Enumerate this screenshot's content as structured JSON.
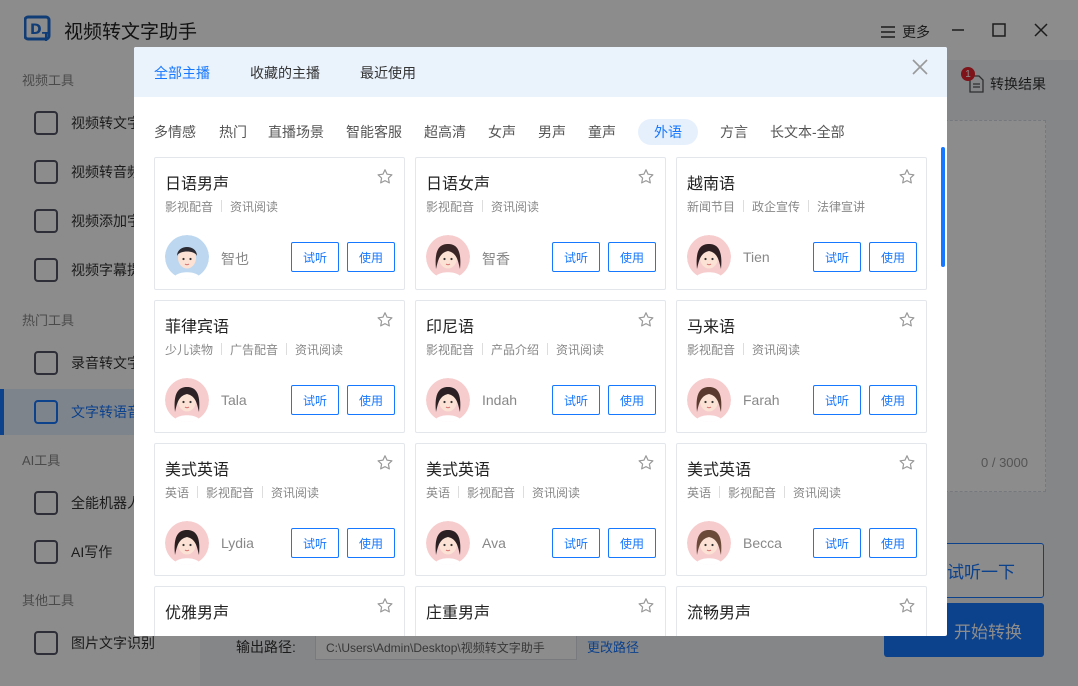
{
  "app": {
    "title": "视频转文字助手",
    "more_label": "更多",
    "result_label": "转换结果",
    "result_badge": "1"
  },
  "sidebar": {
    "sections": [
      "视频工具",
      "热门工具",
      "AI工具",
      "其他工具"
    ],
    "items": [
      {
        "label": "视频转文字",
        "icon": "video-text-icon"
      },
      {
        "label": "视频转音频",
        "icon": "video-audio-icon"
      },
      {
        "label": "视频添加字幕",
        "icon": "video-subtitle-icon"
      },
      {
        "label": "视频字幕提取",
        "icon": "subtitle-extract-icon"
      },
      {
        "label": "录音转文字",
        "icon": "microphone-icon"
      },
      {
        "label": "文字转语音",
        "icon": "text-to-speech-icon"
      },
      {
        "label": "全能机器人",
        "icon": "robot-icon"
      },
      {
        "label": "AI写作",
        "icon": "ai-write-icon"
      },
      {
        "label": "图片文字识别",
        "icon": "image-ocr-icon"
      }
    ]
  },
  "main": {
    "counter": "0 / 3000",
    "listen_button": "试听一下",
    "start_button": "开始转换",
    "output_label": "输出路径:",
    "output_path": "C:\\Users\\Admin\\Desktop\\视频转文字助手",
    "change_path": "更改路径"
  },
  "modal": {
    "tabs": [
      "全部主播",
      "收藏的主播",
      "最近使用"
    ],
    "active_tab": 0,
    "filters": [
      "多情感",
      "热门",
      "直播场景",
      "智能客服",
      "超高清",
      "女声",
      "男声",
      "童声",
      "外语",
      "方言",
      "长文本-全部"
    ],
    "active_filter": 8,
    "try_label": "试听",
    "use_label": "使用",
    "cards": [
      {
        "title": "日语男声",
        "tags": [
          "影视配音",
          "资讯阅读"
        ],
        "name": "智也",
        "gender": "male",
        "hair": "#2b2b33",
        "bg": "#bcd7ef"
      },
      {
        "title": "日语女声",
        "tags": [
          "影视配音",
          "资讯阅读"
        ],
        "name": "智香",
        "gender": "female",
        "hair": "#3a2526",
        "bg": "#f6cccd"
      },
      {
        "title": "越南语",
        "tags": [
          "新闻节目",
          "政企宣传",
          "法律宣讲"
        ],
        "name": "Tien",
        "gender": "female",
        "hair": "#2d1f22",
        "bg": "#f6cccd"
      },
      {
        "title": "菲律宾语",
        "tags": [
          "少儿读物",
          "广告配音",
          "资讯阅读"
        ],
        "name": "Tala",
        "gender": "female",
        "hair": "#2d2226",
        "bg": "#f6cccd"
      },
      {
        "title": "印尼语",
        "tags": [
          "影视配音",
          "产品介绍",
          "资讯阅读"
        ],
        "name": "Indah",
        "gender": "female",
        "hair": "#2b2124",
        "bg": "#f6cccd"
      },
      {
        "title": "马来语",
        "tags": [
          "影视配音",
          "资讯阅读"
        ],
        "name": "Farah",
        "gender": "female",
        "hair": "#5a3a2e",
        "bg": "#f6cccd"
      },
      {
        "title": "美式英语",
        "tags": [
          "英语",
          "影视配音",
          "资讯阅读"
        ],
        "name": "Lydia",
        "gender": "female",
        "hair": "#2a1f20",
        "bg": "#f6cccd"
      },
      {
        "title": "美式英语",
        "tags": [
          "英语",
          "影视配音",
          "资讯阅读"
        ],
        "name": "Ava",
        "gender": "female",
        "hair": "#2a2024",
        "bg": "#f6cccd"
      },
      {
        "title": "美式英语",
        "tags": [
          "英语",
          "影视配音",
          "资讯阅读"
        ],
        "name": "Becca",
        "gender": "female",
        "hair": "#6b4a3a",
        "bg": "#f6cccd"
      },
      {
        "title": "优雅男声",
        "tags": [],
        "name": "",
        "gender": "male",
        "hair": "#2b2b33",
        "bg": "#bcd7ef"
      },
      {
        "title": "庄重男声",
        "tags": [],
        "name": "",
        "gender": "male",
        "hair": "#2b2b33",
        "bg": "#bcd7ef"
      },
      {
        "title": "流畅男声",
        "tags": [],
        "name": "",
        "gender": "male",
        "hair": "#2b2b33",
        "bg": "#bcd7ef"
      }
    ]
  },
  "colors": {
    "accent": "#1677ff",
    "badge": "#e5232e",
    "modal_header": "#eaf2fc"
  }
}
